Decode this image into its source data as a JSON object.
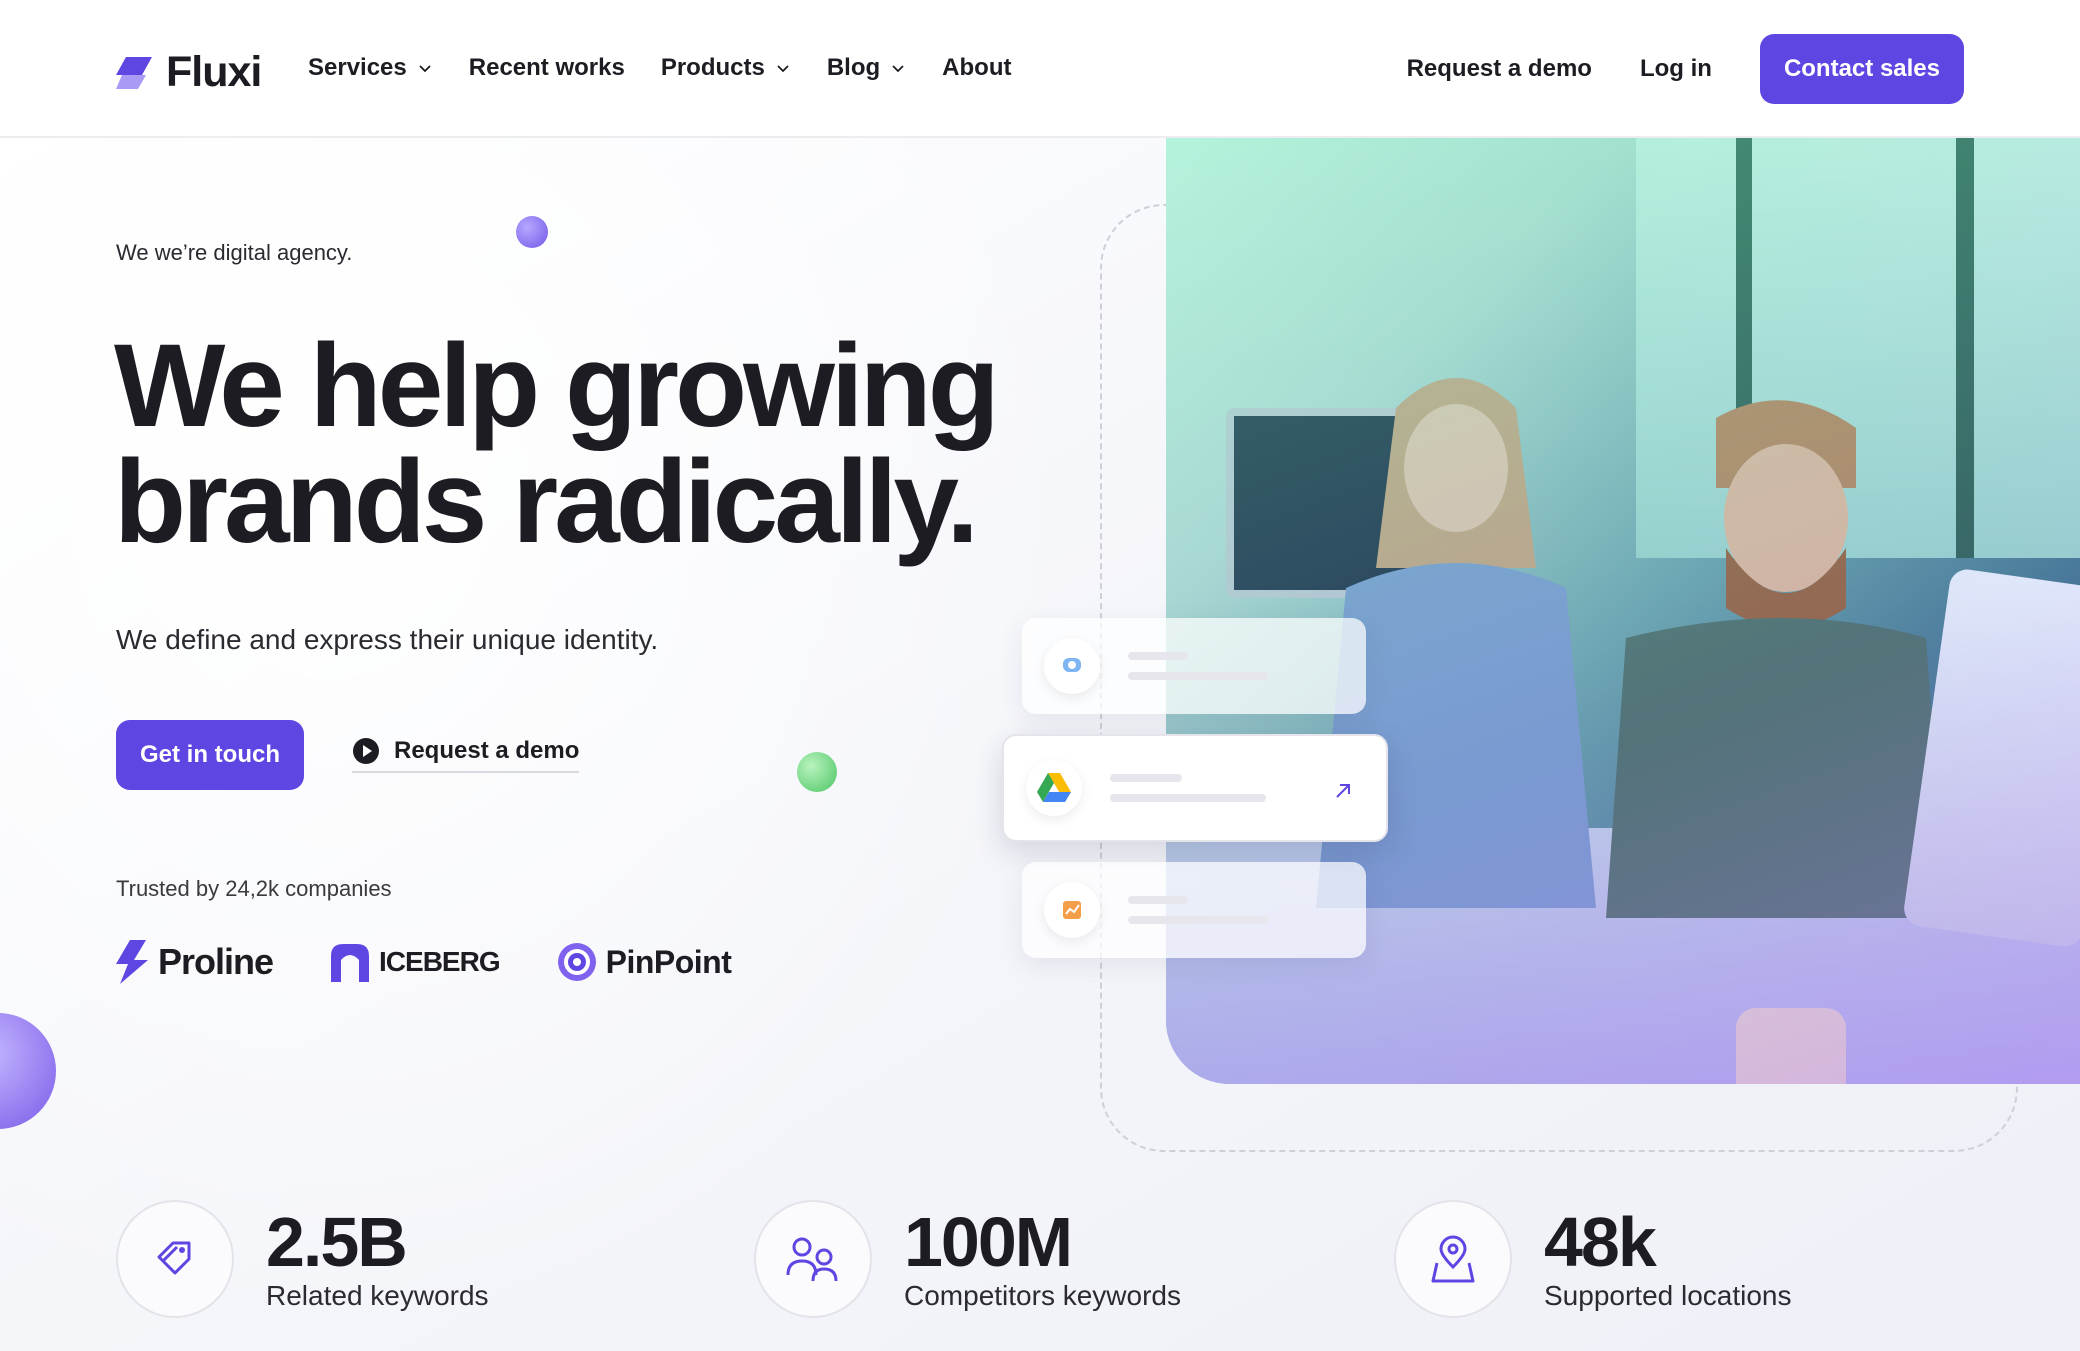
{
  "brand": {
    "name": "Fluxi",
    "accent": "#5E46E3"
  },
  "nav": {
    "items": [
      {
        "label": "Services",
        "dropdown": true
      },
      {
        "label": "Recent works",
        "dropdown": false
      },
      {
        "label": "Products",
        "dropdown": true
      },
      {
        "label": "Blog",
        "dropdown": true
      },
      {
        "label": "About",
        "dropdown": false
      }
    ],
    "request_demo": "Request a demo",
    "login": "Log in",
    "contact": "Contact sales"
  },
  "hero": {
    "tagline": "We we’re digital agency.",
    "headline_line1": "We help growing",
    "headline_line2": "brands radically.",
    "subhead": "We define and express their unique identity.",
    "cta_primary": "Get in touch",
    "cta_secondary": "Request a demo",
    "trusted": "Trusted by 24,2k companies",
    "logos": [
      "Proline",
      "ICEBERG",
      "PinPoint"
    ]
  },
  "floating_cards": [
    {
      "icon": "chat-app-icon"
    },
    {
      "icon": "google-drive-icon",
      "action_icon": "external-arrow-icon"
    },
    {
      "icon": "chart-app-icon"
    }
  ],
  "stats": [
    {
      "value": "2.5B",
      "label": "Related keywords",
      "icon": "tag-icon"
    },
    {
      "value": "100M",
      "label": "Competitors keywords",
      "icon": "users-icon"
    },
    {
      "value": "48k",
      "label": "Supported locations",
      "icon": "map-pin-icon"
    }
  ]
}
